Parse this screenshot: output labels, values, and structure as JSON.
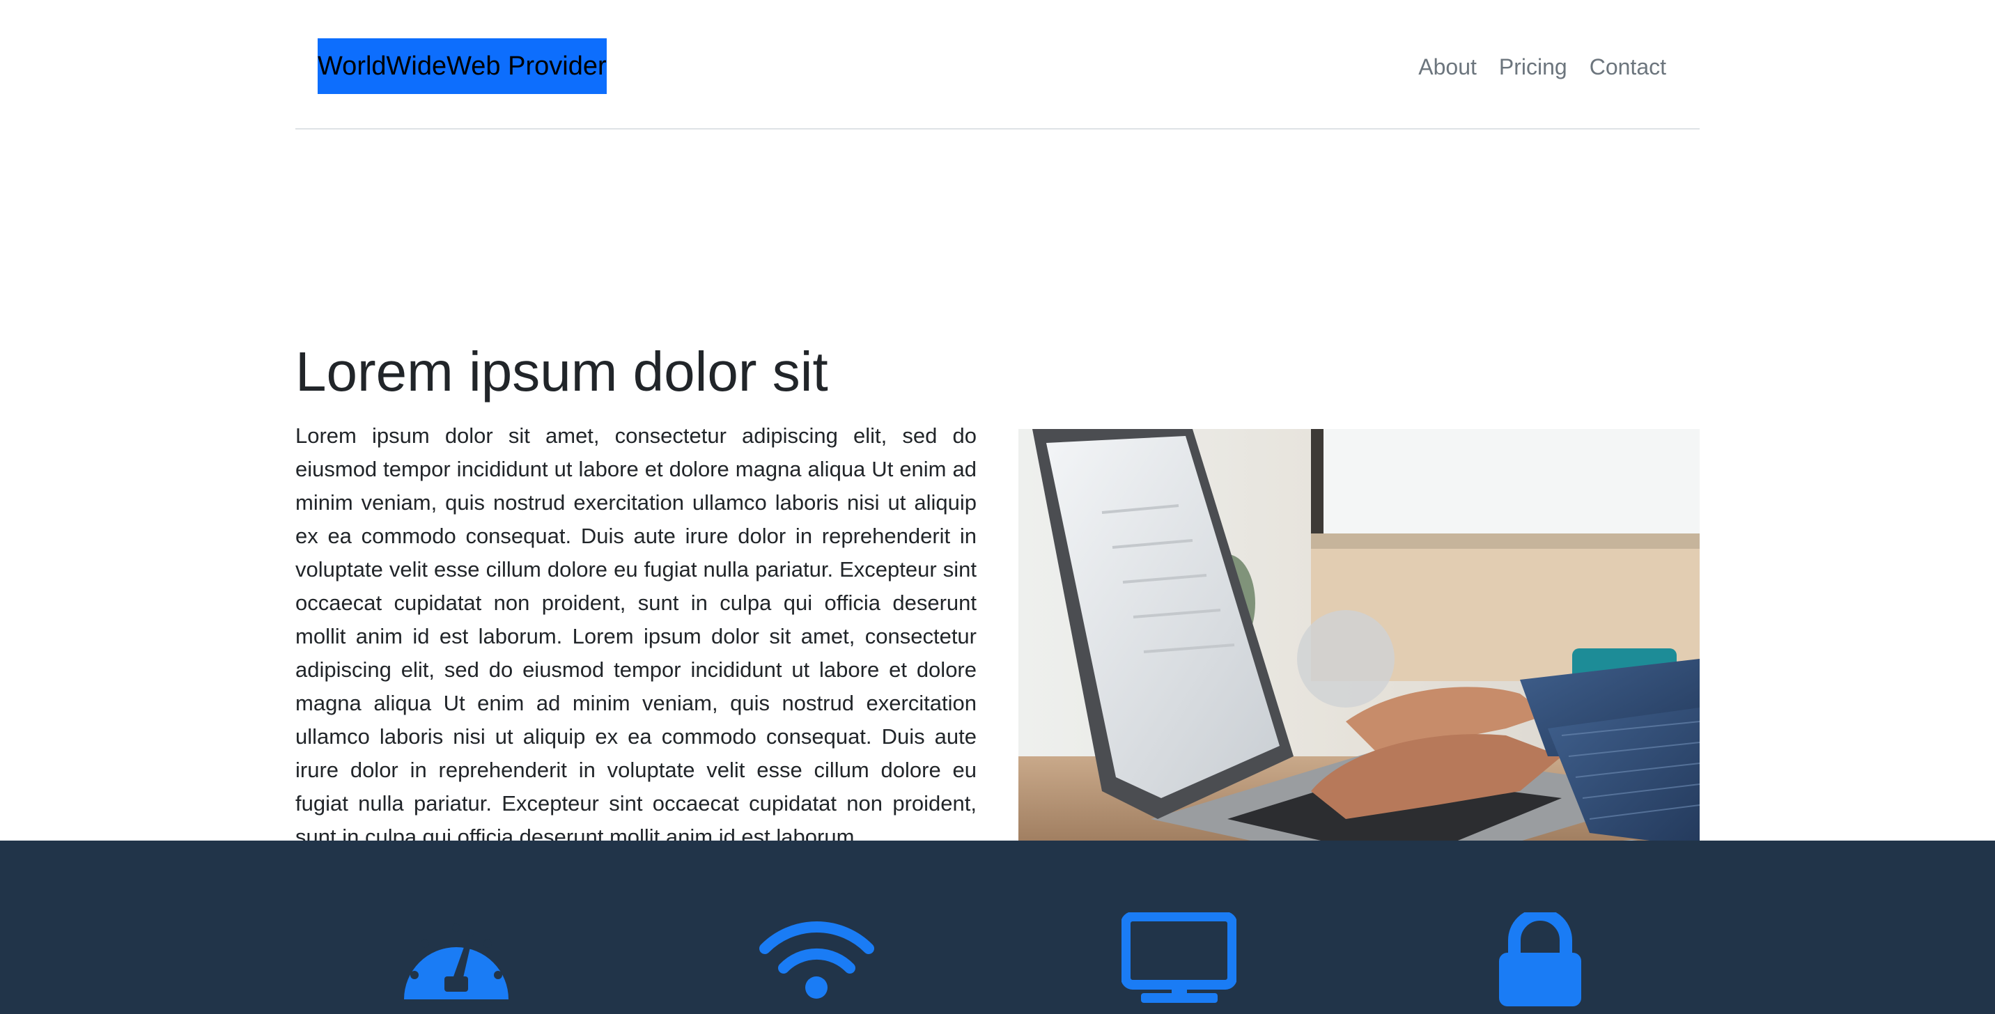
{
  "header": {
    "brand": "WorldWideWeb Provider",
    "nav": [
      {
        "label": "About"
      },
      {
        "label": "Pricing"
      },
      {
        "label": "Contact"
      }
    ]
  },
  "hero": {
    "title": "Lorem ipsum dolor sit",
    "body": "Lorem ipsum dolor sit amet, consectetur adipiscing elit, sed do eiusmod tempor incididunt ut labore et dolore magna aliqua Ut enim ad minim veniam, quis nostrud exercitation ullamco laboris nisi ut aliquip ex ea commodo consequat. Duis aute irure dolor in reprehenderit in voluptate velit esse cillum dolore eu fugiat nulla pariatur. Excepteur sint occaecat cupidatat non proident, sunt in culpa qui officia deserunt mollit anim id est laborum. Lorem ipsum dolor sit amet, consectetur adipiscing elit, sed do eiusmod tempor incididunt ut labore et dolore magna aliqua Ut enim ad minim veniam, quis nostrud exercitation ullamco laboris nisi ut aliquip ex ea commodo consequat. Duis aute irure dolor in reprehenderit in voluptate velit esse cillum dolore eu fugiat nulla pariatur. Excepteur sint occaecat cupidatat non proident, sunt in culpa qui officia deserunt mollit anim id est laborum.",
    "image": "laptop-typing-photo"
  },
  "features": {
    "icons": [
      "speedometer-icon",
      "wifi-icon",
      "monitor-icon",
      "lock-icon"
    ]
  },
  "colors": {
    "brand_highlight": "#0d6efd",
    "nav_text": "#6c757d",
    "features_bg": "#213449",
    "icon_blue": "#1a7cf5"
  }
}
